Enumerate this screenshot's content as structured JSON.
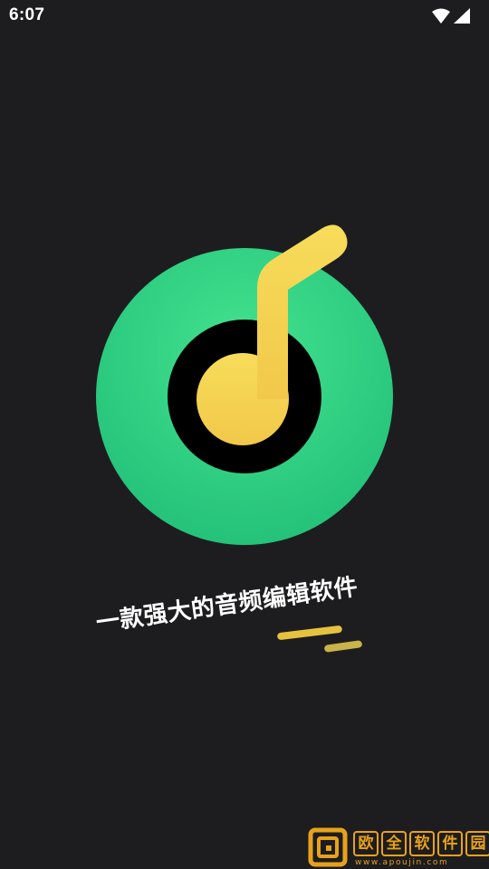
{
  "status_bar": {
    "time": "6:07",
    "wifi_icon": "wifi-icon",
    "signal_icon": "cell-signal-icon"
  },
  "splash": {
    "logo_icon": "music-note-disc-icon",
    "tagline": "一款强大的音频编辑软件",
    "colors": {
      "background": "#1d1d1f",
      "disc_green": "#2fd08a",
      "disc_center": "#000000",
      "note_yellow": "#f6d454",
      "underline": "#e6c33f"
    }
  },
  "watermark": {
    "chars": [
      "欧",
      "全",
      "软",
      "件",
      "园"
    ],
    "url": "www.apoujin.com",
    "color": "#e8a21a"
  }
}
